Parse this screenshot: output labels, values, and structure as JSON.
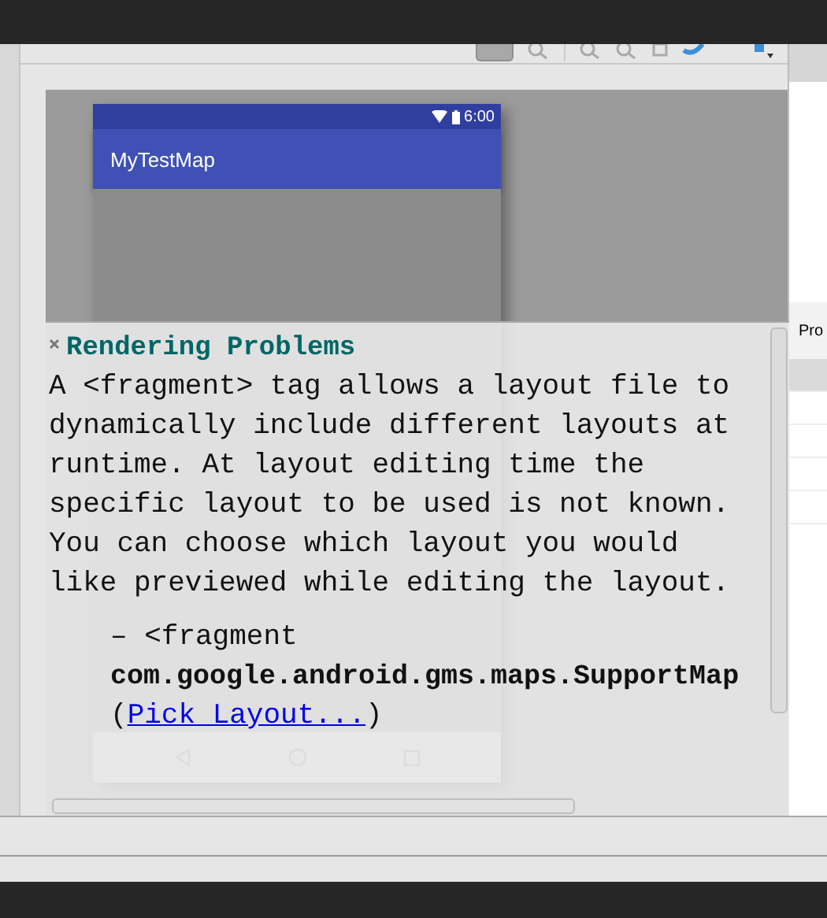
{
  "device": {
    "time": "6:00",
    "app_title": "MyTestMap"
  },
  "problems_panel": {
    "title": "Rendering Problems",
    "message": "A <fragment> tag allows a layout file to dynamically include different layouts at runtime. At layout editing time the specific layout to be used is not known. You can choose which layout you would like previewed while editing the layout.",
    "detail": {
      "prefix": "– <fragment",
      "class_name": "com.google.android.gms.maps.SupportMap",
      "before": "(",
      "link": "Pick Layout...",
      "after": ")"
    }
  },
  "properties_panel": {
    "header": "Pro"
  }
}
